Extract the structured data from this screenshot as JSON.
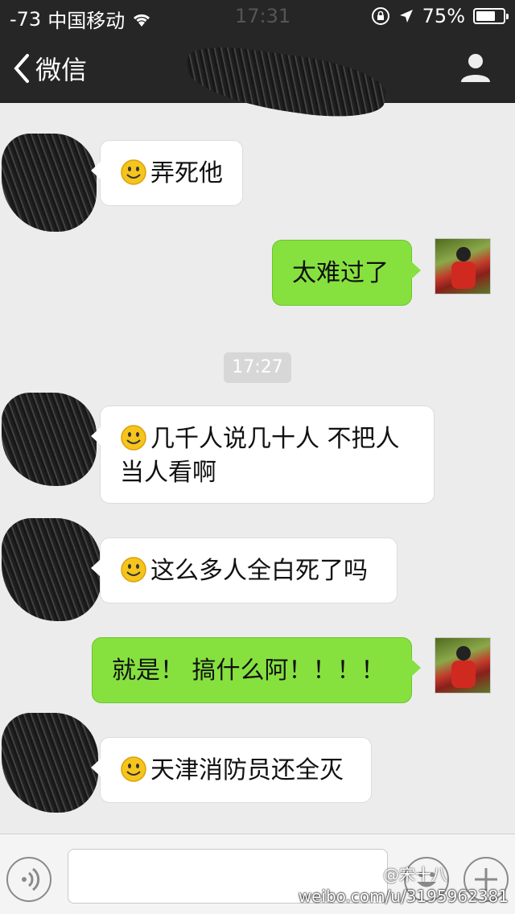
{
  "status_bar": {
    "signal": "-73",
    "carrier": "中国移动",
    "time": "17:31",
    "battery": "75%",
    "battery_level": 0.75
  },
  "navbar": {
    "back_label": "微信"
  },
  "messages": [
    {
      "side": "in",
      "emoji": "smiley-icon",
      "text": "弄死他"
    },
    {
      "side": "out",
      "text": "太难过了"
    },
    {
      "side": "in",
      "emoji": "smiley-icon",
      "text": "几千人说几十人 不把人当人看啊"
    },
    {
      "side": "in",
      "emoji": "smiley-icon",
      "text": "这么多人全白死了吗"
    },
    {
      "side": "out",
      "text": "就是！ 搞什么阿！！！！"
    },
    {
      "side": "in",
      "emoji": "smiley-icon",
      "text": "天津消防员还全灭"
    }
  ],
  "timestamp": "17:27",
  "watermark": {
    "handle": "@宋十八",
    "url": "weibo.com/u/3195962381"
  },
  "colors": {
    "header": "#262626",
    "outgoing_bubble": "#86e13f",
    "incoming_bubble": "#ffffff",
    "background": "#ececec"
  }
}
